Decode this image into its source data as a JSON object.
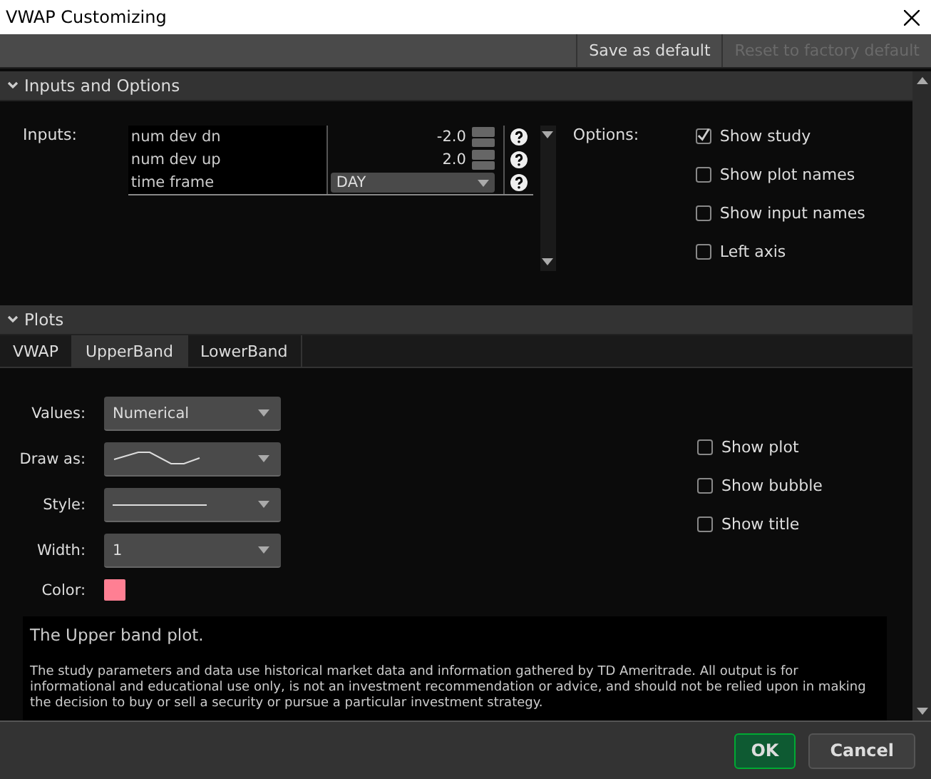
{
  "window": {
    "title": "VWAP Customizing"
  },
  "toolbar": [
    {
      "label": "Save as default",
      "disabled": false
    },
    {
      "label": "Reset to factory default",
      "disabled": true
    }
  ],
  "inputs_section": {
    "title": "Inputs and Options",
    "expanded": true,
    "inputs_label": "Inputs:",
    "options_label": "Options:",
    "inputs": [
      {
        "name": "num dev dn",
        "value": "-2.0",
        "kind": "number"
      },
      {
        "name": "num dev up",
        "value": "2.0",
        "kind": "number"
      },
      {
        "name": "time frame",
        "value": "DAY",
        "kind": "select"
      }
    ],
    "options": [
      {
        "label": "Show study",
        "checked": true
      },
      {
        "label": "Show plot names",
        "checked": false
      },
      {
        "label": "Show input names",
        "checked": false
      },
      {
        "label": "Left axis",
        "checked": false
      }
    ]
  },
  "plots_section": {
    "title": "Plots",
    "expanded": true,
    "tabs": [
      {
        "label": "VWAP",
        "selected": false
      },
      {
        "label": "UpperBand",
        "selected": true
      },
      {
        "label": "LowerBand",
        "selected": false
      }
    ],
    "fields": [
      {
        "label": "Values:",
        "kind": "select",
        "value": "Numerical"
      },
      {
        "label": "Draw as:",
        "kind": "curve"
      },
      {
        "label": "Style:",
        "kind": "line"
      },
      {
        "label": "Width:",
        "kind": "select",
        "value": "1"
      },
      {
        "label": "Color:",
        "kind": "color",
        "color": "#ff7f93"
      }
    ],
    "options": [
      {
        "label": "Show plot",
        "checked": false
      },
      {
        "label": "Show bubble",
        "checked": false
      },
      {
        "label": "Show title",
        "checked": false
      }
    ],
    "description": "The Upper band plot.",
    "disclaimer": "The study parameters and data use historical market data and information gathered by TD Ameritrade. All output is for informational and educational use only, is not an investment recommendation or advice, and should not be relied upon in making the decision to buy or sell a security or pursue a particular investment strategy."
  },
  "buttons": [
    {
      "label": "OK",
      "kind": "primary"
    },
    {
      "label": "Cancel",
      "kind": "secondary"
    }
  ]
}
